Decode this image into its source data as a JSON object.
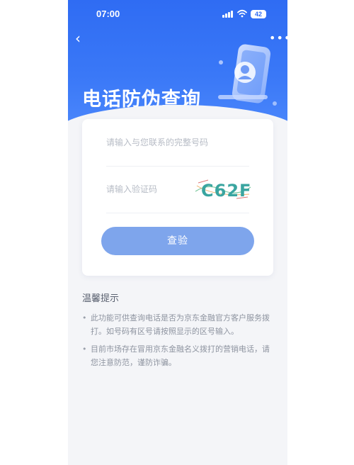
{
  "status_bar": {
    "time": "07:00",
    "battery": "42"
  },
  "header": {
    "title": "电话防伪查询",
    "back_icon": "chevron-left-icon",
    "more_icon": "more-dots-icon"
  },
  "form": {
    "phone_placeholder": "请输入与您联系的完整号码",
    "code_placeholder": "请输入验证码",
    "captcha_text": "C62F",
    "submit_label": "查验"
  },
  "tips": {
    "title": "温馨提示",
    "items": [
      "此功能可供查询电话是否为京东金融官方客户服务拨打。如号码有区号请按照显示的区号输入。",
      "目前市场存在冒用京东金融名义拨打的营销电话，请您注意防范，谨防诈骗。"
    ]
  },
  "colors": {
    "brand_blue": "#2f6cf3",
    "button": "#7ea5ec",
    "background": "#f4f5f8"
  }
}
